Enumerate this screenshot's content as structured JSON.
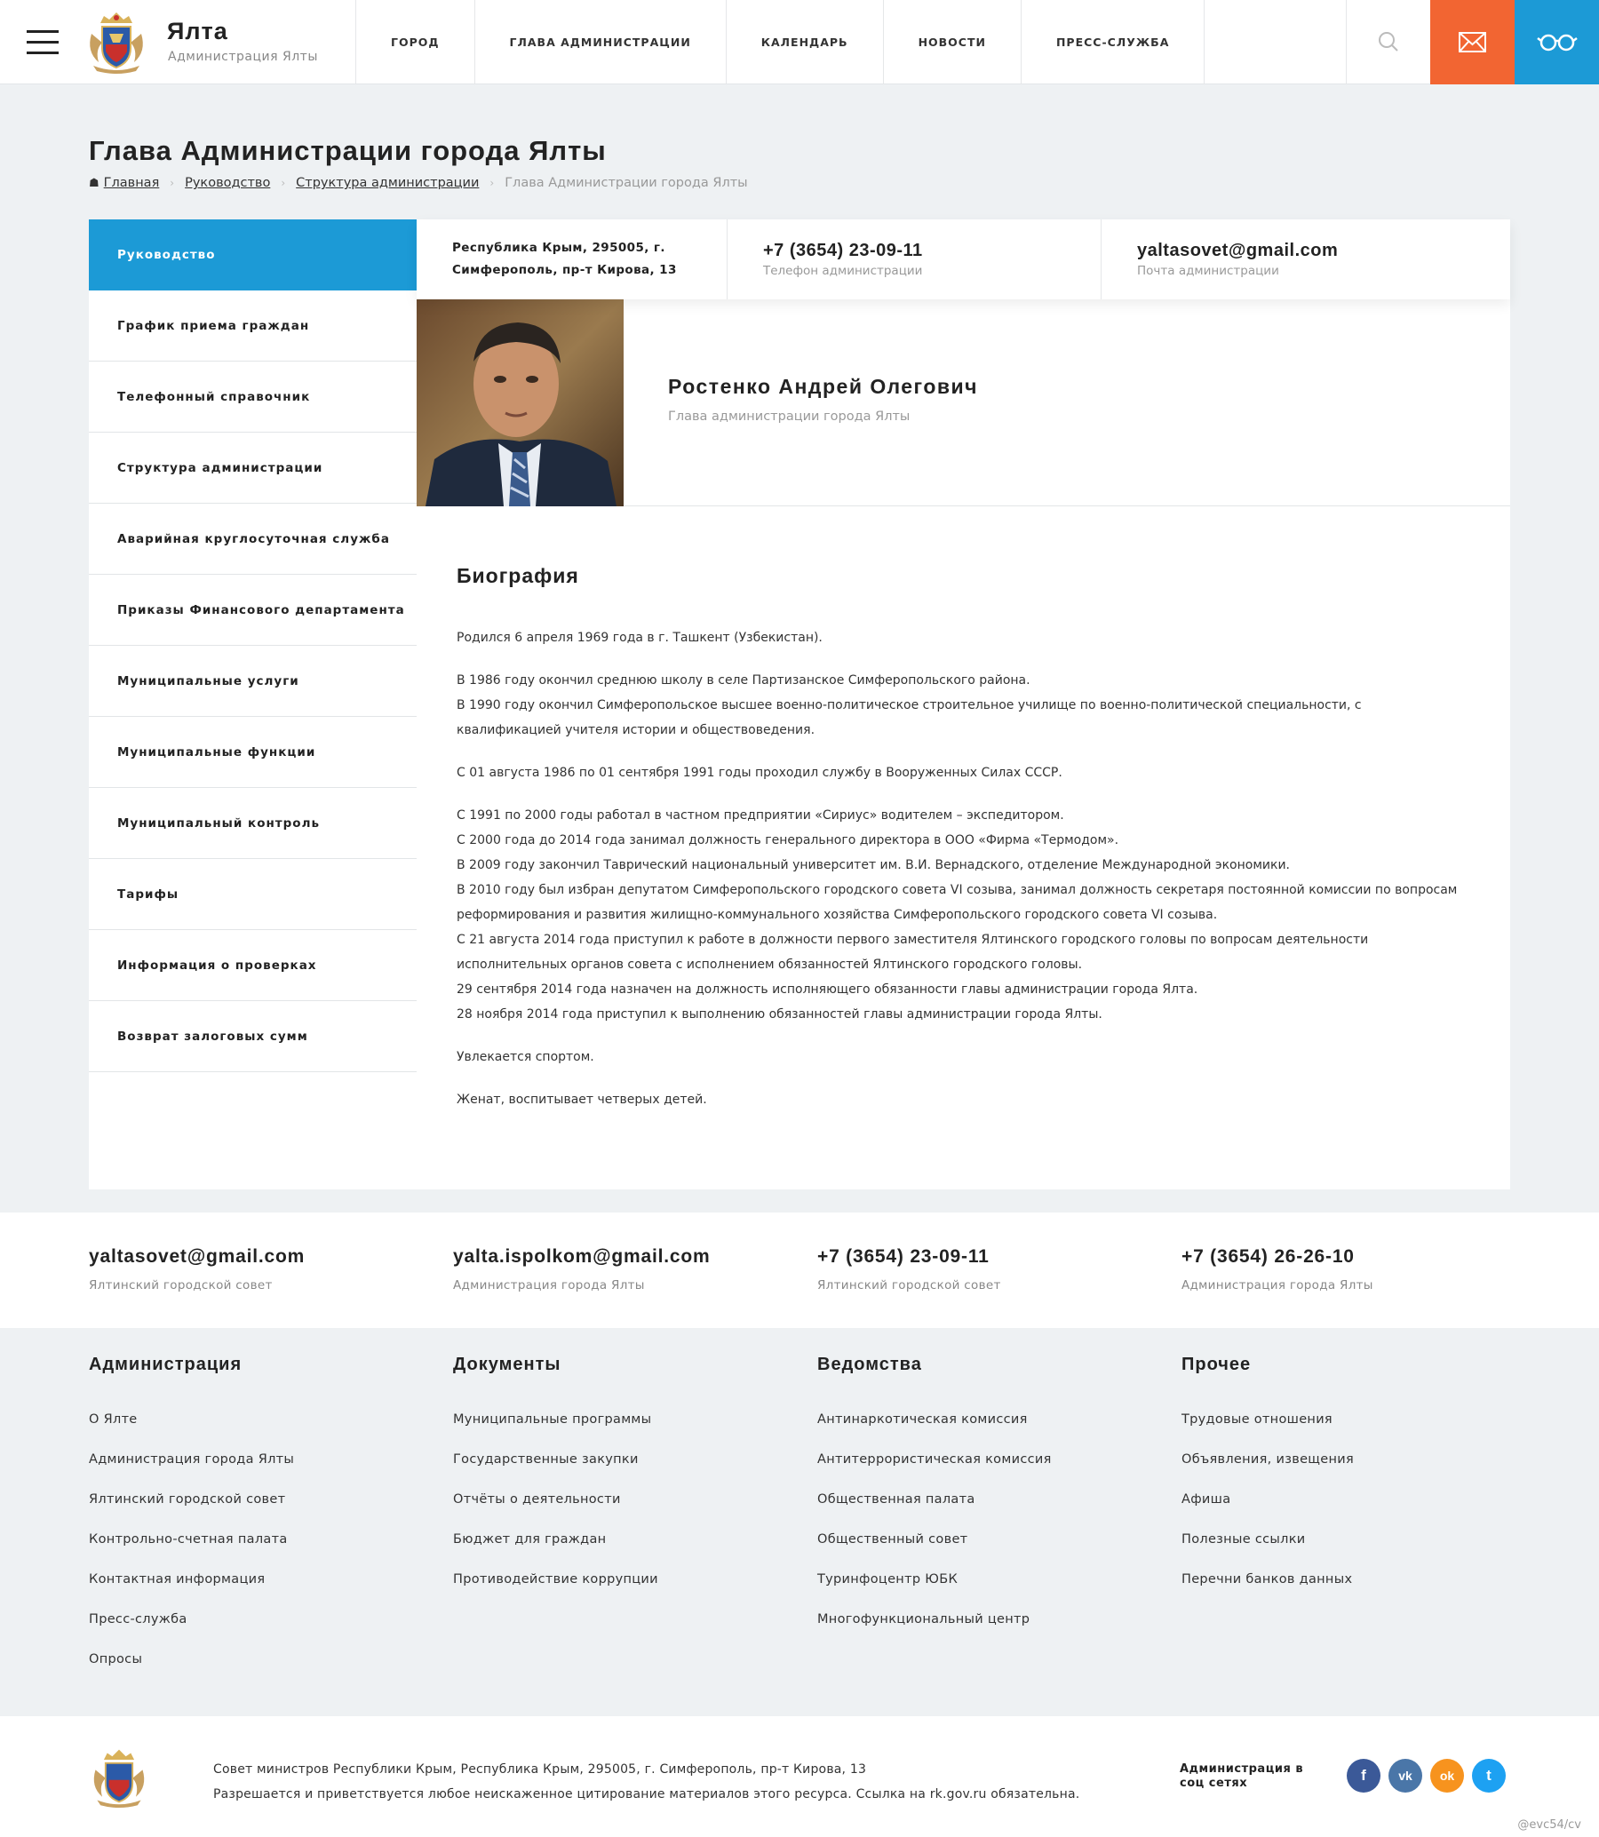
{
  "header": {
    "site_title": "Ялта",
    "site_subtitle": "Администрация Ялты",
    "nav": [
      "ГОРОД",
      "ГЛАВА АДМИНИСТРАЦИИ",
      "КАЛЕНДАРЬ",
      "НОВОСТИ",
      "ПРЕСС-СЛУЖБА"
    ],
    "icons": {
      "menu": "hamburger-icon",
      "search": "search-icon",
      "mail": "envelope-icon",
      "accessibility": "glasses-icon"
    },
    "colors": {
      "mail": "#f26532",
      "accessibility": "#1c9ad6"
    }
  },
  "page": {
    "title": "Глава Администрации города Ялты",
    "breadcrumb": [
      "Главная",
      "Руководство",
      "Структура администрации"
    ],
    "breadcrumb_current": "Глава Администрации города Ялты"
  },
  "sidebar": {
    "items": [
      "Руководство",
      "График приема граждан",
      "Телефонный справочник",
      "Структура администрации",
      "Аварийная круглосуточная служба",
      "Приказы Финансового департамента",
      "Муниципальные услуги",
      "Муниципальные функции",
      "Муниципальный контроль",
      "Тарифы",
      "Информация о проверках",
      "Возврат залоговых сумм"
    ],
    "active_index": 0,
    "active_color": "#1c9ad6"
  },
  "contact_strip": {
    "address_line1": "Республика Крым, 295005, г.",
    "address_line2": "Симферополь, пр-т Кирова, 13",
    "phone": "+7 (3654) 23-09-11",
    "phone_label": "Телефон администрации",
    "email": "yaltasovet@gmail.com",
    "email_label": "Почта администрации"
  },
  "person": {
    "name": "Ростенко Андрей Олегович",
    "role": "Глава администрации города Ялты"
  },
  "bio": {
    "title": "Биография",
    "paragraphs": [
      "Родился 6 апреля 1969 года в г. Ташкент (Узбекистан).",
      "В 1986 году окончил среднюю школу в селе Партизанское Симферопольского района.\nВ 1990 году окончил Симферопольское высшее военно-политическое строительное училище по военно-политической специальности, с квалификацией учителя истории и обществоведения.",
      "С 01 августа 1986 по 01 сентября 1991 годы проходил службу в Вооруженных Силах СССР.",
      "С 1991 по 2000 годы работал в частном предприятии «Сириус» водителем – экспедитором.\nС 2000 года до 2014 года занимал должность генерального директора в ООО «Фирма «Термодом».\nВ 2009 году закончил Таврический национальный университет им. В.И. Вернадского, отделение Международной экономики.\nВ 2010 году был избран депутатом Симферопольского городского совета VI созыва, занимал должность секретаря постоянной комиссии по вопросам реформирования и развития жилищно-коммунального хозяйства Симферопольского городского совета VI созыва.\nС 21 августа 2014 года приступил к работе в должности первого заместителя Ялтинского городского головы по вопросам деятельности исполнительных органов совета с исполнением обязанностей Ялтинского городского головы.\n29 сентября 2014 года назначен на должность исполняющего обязанности главы администрации города Ялта.\n28 ноября 2014 года приступил к выполнению обязанностей главы администрации города Ялты.",
      "Увлекается спортом.",
      "Женат, воспитывает четверых детей."
    ]
  },
  "footer_contacts": [
    {
      "value": "yaltasovet@gmail.com",
      "label": "Ялтинский городской совет"
    },
    {
      "value": "yalta.ispolkom@gmail.com",
      "label": "Администрация города Ялты"
    },
    {
      "value": "+7 (3654) 23-09-11",
      "label": "Ялтинский городской совет"
    },
    {
      "value": "+7 (3654) 26-26-10",
      "label": "Администрация города Ялты"
    }
  ],
  "footer_menu": [
    {
      "title": "Администрация",
      "links": [
        "О Ялте",
        "Администрация города Ялты",
        "Ялтинский городской совет",
        "Контрольно-счетная палата",
        "Контактная информация",
        "Пресс-служба",
        "Опросы"
      ]
    },
    {
      "title": "Документы",
      "links": [
        "Муниципальные программы",
        "Государственные закупки",
        "Отчёты о деятельности",
        "Бюджет для граждан",
        "Противодействие коррупции"
      ]
    },
    {
      "title": "Ведомства",
      "links": [
        "Антинаркотическая комиссия",
        "Антитеррористическая комиссия",
        "Общественная палата",
        "Общественный совет",
        "Туринфоцентр ЮБК",
        "Многофункциональный центр"
      ]
    },
    {
      "title": "Прочее",
      "links": [
        "Трудовые отношения",
        "Объявления, извещения",
        "Афиша",
        "Полезные ссылки",
        "Перечни банков данных"
      ]
    }
  ],
  "bottom": {
    "line1": "Совет министров Республики Крым, Республика Крым, 295005, г. Симферополь, пр-т Кирова, 13",
    "line2": "Разрешается и приветствуется любое неискаженное цитирование материалов этого ресурса. Ссылка на rk.gov.ru обязательна.",
    "social_label": "Администрация в соц сетях",
    "social": [
      {
        "name": "facebook-icon",
        "glyph": "f",
        "color": "#3b5998"
      },
      {
        "name": "vk-icon",
        "glyph": "vk",
        "color": "#4a76a8"
      },
      {
        "name": "odnoklassniki-icon",
        "glyph": "ok",
        "color": "#f7931e"
      },
      {
        "name": "twitter-icon",
        "glyph": "t",
        "color": "#1da1f2"
      }
    ],
    "watermark": "@evc54/cv"
  }
}
